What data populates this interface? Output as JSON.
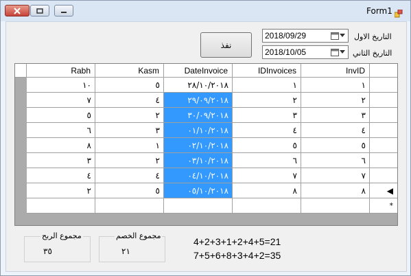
{
  "window": {
    "title": "Form1",
    "caption_buttons": [
      "close",
      "maximize",
      "minimize"
    ]
  },
  "toolbar": {
    "apply_label": "نفذ",
    "date_from": {
      "label": "التاريخ الاول",
      "value": "2018/09/29"
    },
    "date_to": {
      "label": "التاريخ الثاني",
      "value": "2018/10/05"
    }
  },
  "grid": {
    "columns": [
      "Rabh",
      "Kasm",
      "DateInvoice",
      "IDInvoices",
      "InvID"
    ],
    "rows": [
      [
        "١٠",
        "٥",
        "٢٨/١٠/٢٠١٨",
        "١",
        "١"
      ],
      [
        "٧",
        "٤",
        "٢٩/٠٩/٢٠١٨",
        "٢",
        "٢"
      ],
      [
        "٥",
        "٢",
        "٣٠/٠٩/٢٠١٨",
        "٣",
        "٣"
      ],
      [
        "٦",
        "٣",
        "٠١/١٠/٢٠١٨",
        "٤",
        "٤"
      ],
      [
        "٨",
        "١",
        "٠٢/١٠/٢٠١٨",
        "٥",
        "٥"
      ],
      [
        "٣",
        "٢",
        "٠٣/١٠/٢٠١٨",
        "٦",
        "٦"
      ],
      [
        "٤",
        "٤",
        "٠٤/١٠/٢٠١٨",
        "٧",
        "٧"
      ],
      [
        "٢",
        "٥",
        "٠٥/١٠/٢٠١٨",
        "٨",
        "٨"
      ]
    ],
    "selected_column": "DateInvoice",
    "selected_rows": [
      1,
      2,
      3,
      4,
      5,
      6,
      7
    ],
    "current_row_marker": "◀",
    "new_row_marker": "*"
  },
  "summary": {
    "profit": {
      "label": "مجموع الربح",
      "value": "٣٥"
    },
    "discount": {
      "label": "مجموع الخصم",
      "value": "٢١"
    },
    "formula_discount": "4+2+3+1+2+4+5=21",
    "formula_profit": "7+5+6+8+3+4+2=35"
  },
  "colors": {
    "selection": "#3399ff",
    "close_button": "#c7433a"
  }
}
